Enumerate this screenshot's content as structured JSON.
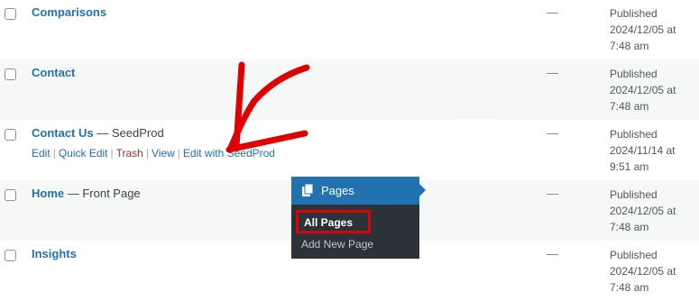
{
  "rows": [
    {
      "title": "Comparisons",
      "state": "",
      "dash": "—",
      "status": "Published",
      "date": "2024/12/05 at",
      "time": "7:48 am"
    },
    {
      "title": "Contact",
      "state": "",
      "dash": "—",
      "status": "Published",
      "date": "2024/12/05 at",
      "time": "7:48 am"
    },
    {
      "title": "Contact Us",
      "state": " — SeedProd",
      "dash": "—",
      "status": "Published",
      "date": "2024/11/14 at",
      "time": "9:51 am"
    },
    {
      "title": "Home",
      "state": " — Front Page",
      "dash": "—",
      "status": "Published",
      "date": "2024/12/05 at",
      "time": "7:48 am"
    },
    {
      "title": "Insights",
      "state": "",
      "dash": "—",
      "status": "Published",
      "date": "2024/12/05 at",
      "time": "7:48 am"
    }
  ],
  "row_actions": {
    "edit": "Edit",
    "quick_edit": "Quick Edit",
    "trash": "Trash",
    "view": "View",
    "edit_seedprod": "Edit with SeedProd",
    "separator": "|"
  },
  "menu": {
    "title": "Pages",
    "icon": "pages-icon",
    "items": [
      "All Pages",
      "Add New Page"
    ],
    "active_item": "All Pages"
  },
  "colors": {
    "link": "#2271b1",
    "trash": "#b32d2e",
    "menu_bg": "#2c3338",
    "menu_active": "#2271b1",
    "highlight": "#e00000"
  }
}
